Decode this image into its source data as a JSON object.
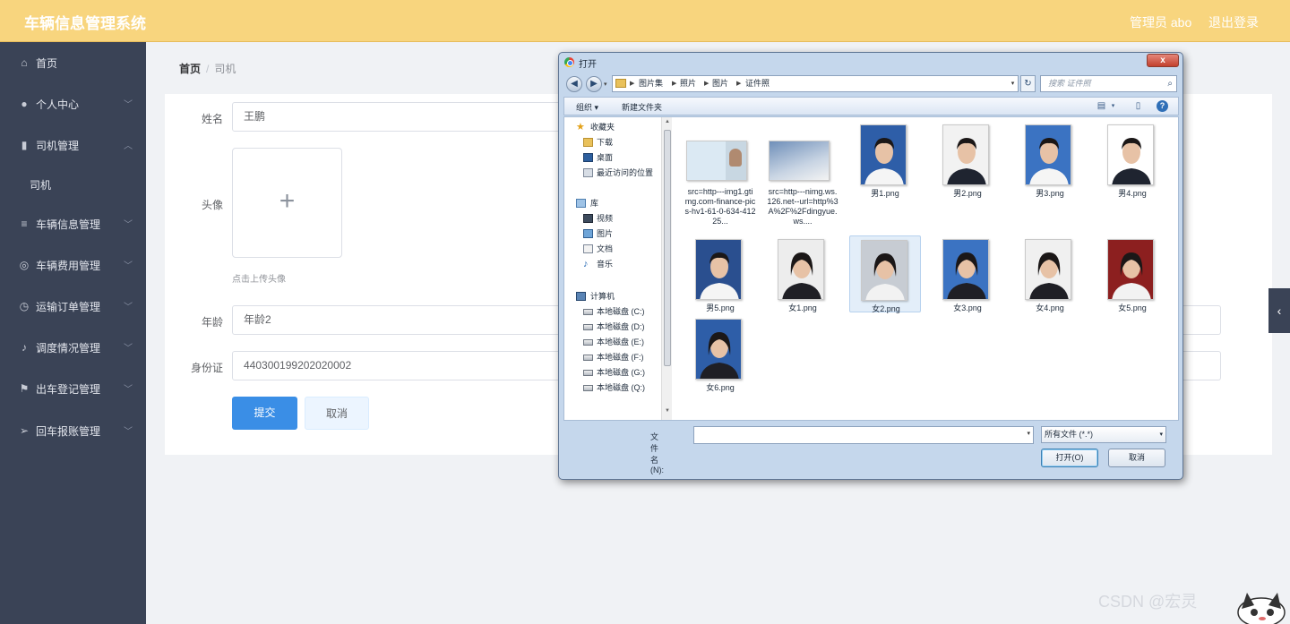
{
  "app": {
    "title": "车辆信息管理系统",
    "user": "管理员 abo",
    "logout": "退出登录"
  },
  "sidebar": {
    "items": [
      {
        "label": "首页",
        "icon": "home-icon",
        "glyph": "⌂"
      },
      {
        "label": "个人中心",
        "icon": "user-icon",
        "glyph": "●"
      },
      {
        "label": "司机管理",
        "icon": "chart-icon",
        "glyph": "▮"
      },
      {
        "label": "司机",
        "icon": "",
        "glyph": ""
      },
      {
        "label": "车辆信息管理",
        "icon": "list-icon",
        "glyph": "≡"
      },
      {
        "label": "车辆费用管理",
        "icon": "circle-icon",
        "glyph": "◎"
      },
      {
        "label": "运输订单管理",
        "icon": "compass-icon",
        "glyph": "◷"
      },
      {
        "label": "调度情况管理",
        "icon": "microphone-icon",
        "glyph": "♪"
      },
      {
        "label": "出车登记管理",
        "icon": "flag-icon",
        "glyph": "⚑"
      },
      {
        "label": "回车报账管理",
        "icon": "send-icon",
        "glyph": "➢"
      }
    ]
  },
  "breadcrumb": {
    "home": "首页",
    "sep": "/",
    "current": "司机"
  },
  "form": {
    "name_label": "姓名",
    "name_value": "王鹏",
    "avatar_label": "头像",
    "upload_plus": "+",
    "upload_hint": "点击上传头像",
    "age_label": "年龄",
    "age_value": "年龄2",
    "id_label": "身份证",
    "id_value": "440300199202020002",
    "submit": "提交",
    "cancel": "取消"
  },
  "side_tab": "‹",
  "watermark": "CSDN @宏灵",
  "dialog": {
    "title": "打开",
    "close": "x",
    "path": [
      "图片集",
      "照片",
      "图片",
      "证件照"
    ],
    "search_placeholder": "搜索 证件照",
    "toolbar": {
      "organize": "组织 ▾",
      "new_folder": "新建文件夹"
    },
    "tree": [
      {
        "label": "收藏夹",
        "kind": "star"
      },
      {
        "label": "下载",
        "kind": "folder"
      },
      {
        "label": "桌面",
        "kind": "desktop"
      },
      {
        "label": "最近访问的位置",
        "kind": "recent"
      },
      {
        "label": "库",
        "kind": "lib"
      },
      {
        "label": "视频",
        "kind": "video"
      },
      {
        "label": "图片",
        "kind": "pic"
      },
      {
        "label": "文档",
        "kind": "doc"
      },
      {
        "label": "音乐",
        "kind": "music"
      },
      {
        "label": "计算机",
        "kind": "pc"
      },
      {
        "label": "本地磁盘 (C:)",
        "kind": "disk"
      },
      {
        "label": "本地磁盘 (D:)",
        "kind": "disk"
      },
      {
        "label": "本地磁盘 (E:)",
        "kind": "disk"
      },
      {
        "label": "本地磁盘 (F:)",
        "kind": "disk"
      },
      {
        "label": "本地磁盘 (G:)",
        "kind": "disk"
      },
      {
        "label": "本地磁盘 (Q:)",
        "kind": "disk"
      }
    ],
    "files": [
      {
        "name": "src=http---img1.gtimg.com-finance-pics-hv1-61-0-634-41225...",
        "kind": "card1"
      },
      {
        "name": "src=http---nimg.ws.126.net--url=http%3A%2F%2Fdingyue.ws....",
        "kind": "card2"
      },
      {
        "name": "男1.png",
        "kind": "m"
      },
      {
        "name": "男2.png",
        "kind": "m"
      },
      {
        "name": "男3.png",
        "kind": "m"
      },
      {
        "name": "男4.png",
        "kind": "m"
      },
      {
        "name": "男5.png",
        "kind": "m"
      },
      {
        "name": "女1.png",
        "kind": "f"
      },
      {
        "name": "女2.png",
        "kind": "f",
        "selected": true
      },
      {
        "name": "女3.png",
        "kind": "f"
      },
      {
        "name": "女4.png",
        "kind": "f"
      },
      {
        "name": "女5.png",
        "kind": "f"
      },
      {
        "name": "女6.png",
        "kind": "f"
      }
    ],
    "filename_label": "文件名(N):",
    "filename_value": "",
    "filetype": "所有文件 (*.*)",
    "open": "打开(O)",
    "cancel": "取消"
  },
  "colors": {
    "topbar": "#f8d57e",
    "sidebar": "#3a4356",
    "primary": "#3a8ee6"
  }
}
